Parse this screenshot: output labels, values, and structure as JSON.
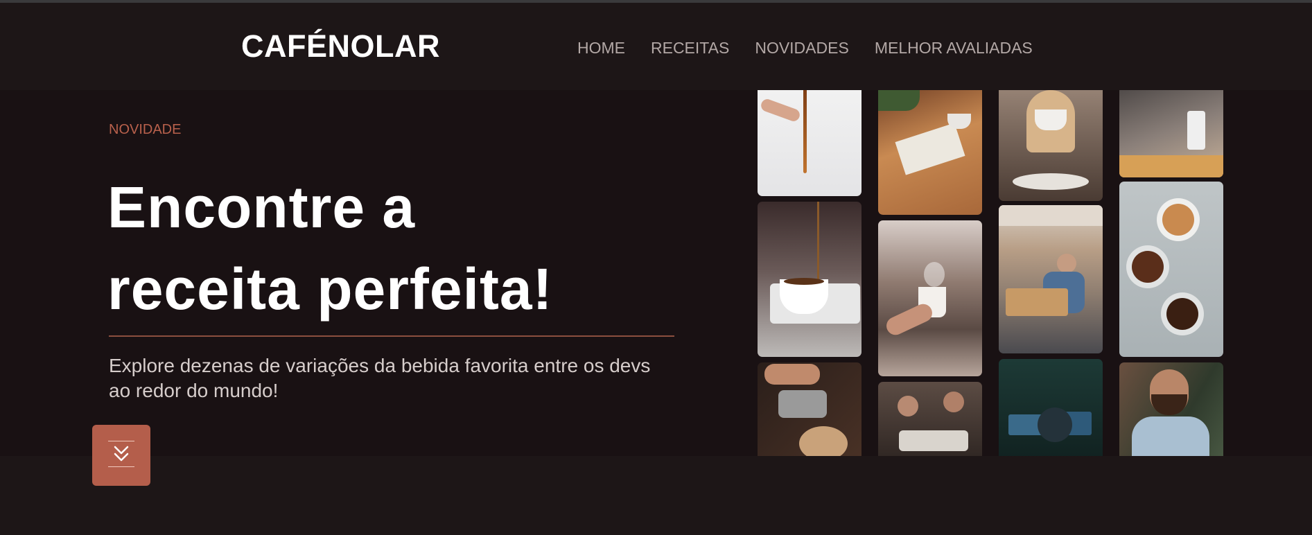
{
  "brand": {
    "name": "CAFÉNOLAR"
  },
  "nav": {
    "items": [
      {
        "label": "HOME"
      },
      {
        "label": "RECEITAS"
      },
      {
        "label": "NOVIDADES"
      },
      {
        "label": "MELHOR AVALIADAS"
      }
    ]
  },
  "hero": {
    "tag": "NOVIDADE",
    "title_line1": "Encontre a",
    "title_line2": "receita perfeita!",
    "description": "Explore dezenas de variações da bebida favorita entre os devs ao redor do mundo!"
  },
  "scroll_button": {
    "icon": "double-chevron-down-icon"
  },
  "gallery": {
    "photos": [
      "coffee-pour-from-hand-photo",
      "coffee-pour-into-cup-photo",
      "latte-art-pour-photo",
      "desk-with-notebook-and-coffee-photo",
      "hand-holding-steaming-cup-photo",
      "baristas-at-counter-photo",
      "woman-drinking-coffee-photo",
      "office-team-meeting-photo",
      "developer-at-computers-photo",
      "espresso-machine-photo",
      "latte-and-coffee-beans-photo",
      "smiling-man-at-laptop-photo"
    ]
  },
  "colors": {
    "background": "#1d1617",
    "hero_background": "#191113",
    "accent": "#b45e4b",
    "nav_text": "#b3a8a6"
  }
}
